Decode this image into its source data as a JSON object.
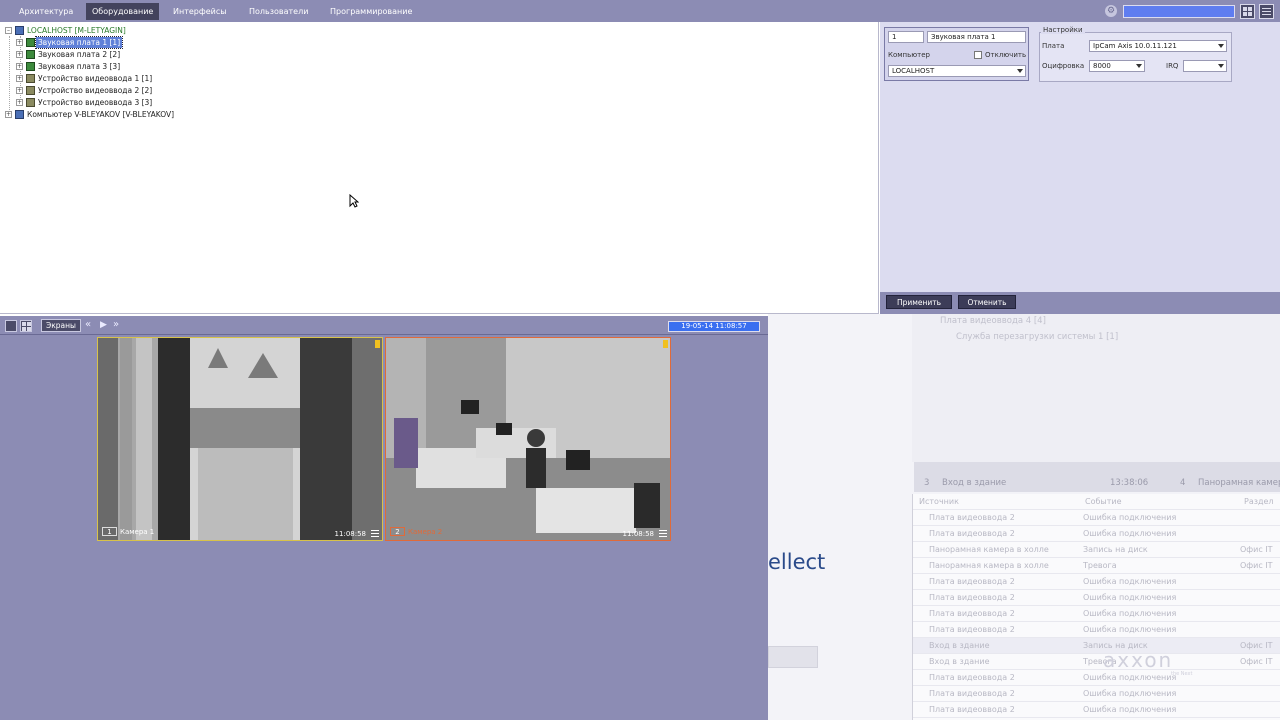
{
  "menu": {
    "tabs": [
      "Архитектура",
      "Оборудование",
      "Интерфейсы",
      "Пользователи",
      "Программирование"
    ],
    "active_index": 1
  },
  "tree": {
    "items": [
      {
        "label": "LOCALHOST [M-LETYAGIN]",
        "icon": "computer-icon"
      },
      {
        "label": "Звуковая плата 1 [1]",
        "icon": "sound-card-icon",
        "selected": true
      },
      {
        "label": "Звуковая плата 2 [2]",
        "icon": "sound-card-icon"
      },
      {
        "label": "Звуковая плата 3 [3]",
        "icon": "sound-card-icon"
      },
      {
        "label": "Устройство видеоввода 1 [1]",
        "icon": "video-input-icon"
      },
      {
        "label": "Устройство видеоввода 2 [2]",
        "icon": "video-input-icon"
      },
      {
        "label": "Устройство видеоввода 3 [3]",
        "icon": "video-input-icon"
      },
      {
        "label": "Компьютер V-BLEYAKOV [V-BLEYAKOV]",
        "icon": "computer-icon"
      }
    ]
  },
  "settings": {
    "id_value": "1",
    "name_value": "Звуковая плата 1",
    "computer_label": "Компьютер",
    "disable_label": "Отключить",
    "computer_value": "LOCALHOST",
    "group_title": "Настройки",
    "board_label": "Плата",
    "board_value": "IpCam Axis 10.0.11.121",
    "digitize_label": "Оцифровка",
    "digitize_value": "8000",
    "irq_label": "IRQ",
    "irq_value": "",
    "apply_label": "Применить",
    "cancel_label": "Отменить"
  },
  "video": {
    "screens_label": "Экраны",
    "clock": "19-05-14   11:08:57",
    "cameras": [
      {
        "number": "1",
        "name": "Камера 1",
        "time": "11:08:58"
      },
      {
        "number": "2",
        "name": "Камера 2",
        "time": "11:08:58"
      }
    ]
  },
  "background": {
    "tree_lines": [
      "Плата видеоввода 4 [4]",
      "Служба перезагрузки системы 1 [1]"
    ],
    "strip_items": [
      {
        "number": "3",
        "label": "Вход в здание",
        "time": "13:38:06"
      },
      {
        "number": "4",
        "label": "Панорамная камера"
      }
    ],
    "table_headers": [
      "Источник",
      "Событие",
      "Раздел"
    ],
    "table_rows": [
      {
        "source": "Плата видеоввода 2",
        "event": "Ошибка подключения",
        "section": ""
      },
      {
        "source": "Плата видеоввода 2",
        "event": "Ошибка подключения",
        "section": ""
      },
      {
        "source": "Панорамная камера в холле",
        "event": "Запись на диск",
        "section": "Офис IT"
      },
      {
        "source": "Панорамная камера в холле",
        "event": "Тревога",
        "section": "Офис IT"
      },
      {
        "source": "Плата видеоввода 2",
        "event": "Ошибка подключения",
        "section": ""
      },
      {
        "source": "Плата видеоввода 2",
        "event": "Ошибка подключения",
        "section": ""
      },
      {
        "source": "Плата видеоввода 2",
        "event": "Ошибка подключения",
        "section": ""
      },
      {
        "source": "Плата видеоввода 2",
        "event": "Ошибка подключения",
        "section": ""
      },
      {
        "source": "Вход в здание",
        "event": "Запись на диск",
        "section": "Офис IT"
      },
      {
        "source": "Вход в здание",
        "event": "Тревога",
        "section": "Офис IT"
      },
      {
        "source": "Плата видеоввода 2",
        "event": "Ошибка подключения",
        "section": ""
      },
      {
        "source": "Плата видеоввода 2",
        "event": "Ошибка подключения",
        "section": ""
      },
      {
        "source": "Плата видеоввода 2",
        "event": "Ошибка подключения",
        "section": ""
      }
    ],
    "intellect_text": "ellect",
    "logo_text": "axxon",
    "logo_slogan": "the Next"
  },
  "colors": {
    "panel": "#8c8cb4",
    "active_tab": "#43435d",
    "settings_bg": "#dcdcf0",
    "selection": "#5f80d8",
    "clock_bg": "#3a6ff0",
    "cam1_border": "#d8c24a",
    "cam2_border": "#e06a3a"
  }
}
